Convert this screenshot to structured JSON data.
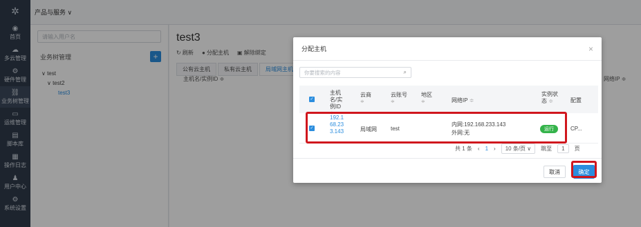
{
  "nav": {
    "items": [
      {
        "label": "首页",
        "icon": "home-icon",
        "glyph": "◉"
      },
      {
        "label": "多云管理",
        "icon": "cloud-icon",
        "glyph": "☁"
      },
      {
        "label": "硬件管理",
        "icon": "hardware-icon",
        "glyph": "⚙"
      },
      {
        "label": "业务树管理",
        "icon": "tree-icon",
        "glyph": "⛓"
      },
      {
        "label": "运维管理",
        "icon": "monitor-icon",
        "glyph": "▭"
      },
      {
        "label": "脚本库",
        "icon": "script-icon",
        "glyph": "▤"
      },
      {
        "label": "操作日志",
        "icon": "log-icon",
        "glyph": "▦"
      },
      {
        "label": "用户中心",
        "icon": "user-icon",
        "glyph": "♟"
      },
      {
        "label": "系统设置",
        "icon": "settings-icon",
        "glyph": "⚙"
      }
    ],
    "active_index": 3
  },
  "topbar": {
    "menu_label": "产品与服务 ∨"
  },
  "tree": {
    "search_placeholder": "请输入用户名",
    "title": "业务树管理",
    "add_label": "+",
    "nodes": [
      "∨ test",
      "∨ test2",
      "test3"
    ]
  },
  "main": {
    "title": "test3",
    "toolbar": [
      {
        "icon": "refresh-icon",
        "label": "↻ 刷新"
      },
      {
        "icon": "assign-icon",
        "label": "● 分配主机"
      },
      {
        "icon": "unbind-icon",
        "label": "▣ 解除绑定"
      }
    ],
    "tabs": [
      "公有云主机",
      "私有云主机",
      "局域网主机"
    ],
    "table_col1": "主机名/实例ID ≑",
    "table_col_right": "网络IP ≑"
  },
  "modal": {
    "title": "分配主机",
    "close": "×",
    "search_placeholder": "你要搜索的内容",
    "search_icon": "⌕",
    "columns": {
      "check": "✓",
      "host": "主机名/实例ID",
      "cloud": "云商",
      "account": "云账号",
      "region": "地区",
      "ip": "网络IP",
      "status": "实例状态",
      "config": "配置",
      "sort": "≑"
    },
    "row": {
      "host": "192.168.233.143",
      "cloud": "局域网",
      "account": "test",
      "ip_inner": "内网:192.168.233.143",
      "ip_outer": "外网:无",
      "status": "运行",
      "config": "CP..."
    },
    "pager": {
      "total": "共 1 条",
      "prev": "‹",
      "current": "1",
      "next": "›",
      "page_size": "10 条/页 ∨",
      "goto": "跳至",
      "goto_value": "1",
      "page_unit": "页"
    },
    "cancel_label": "取消",
    "ok_label": "确定"
  }
}
